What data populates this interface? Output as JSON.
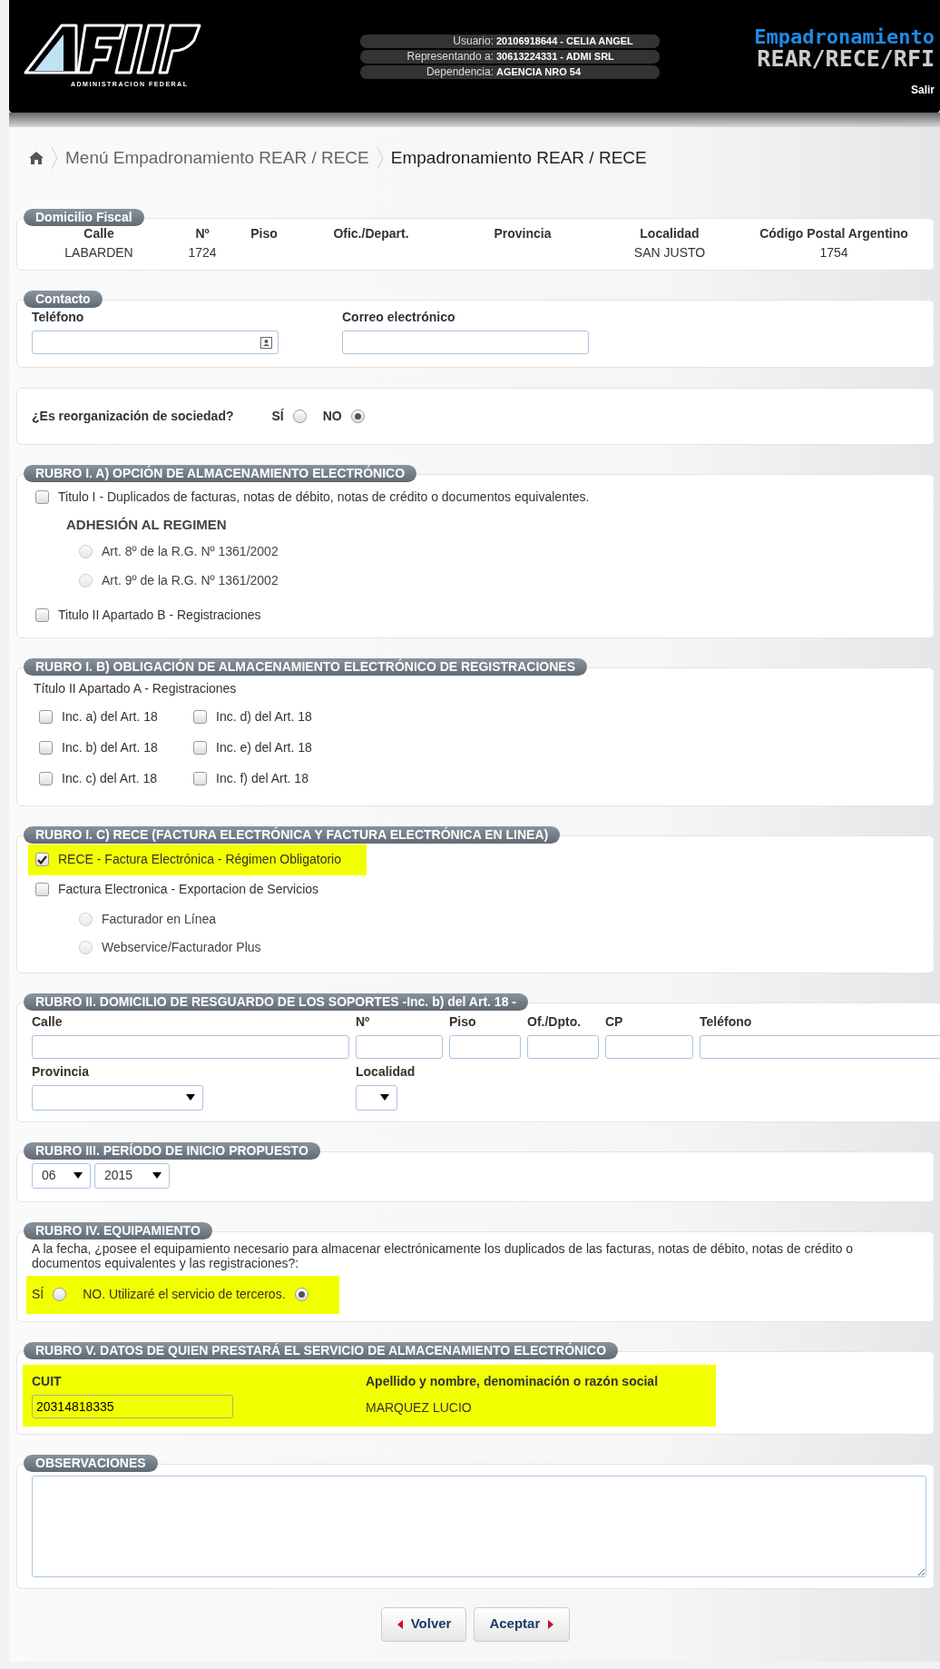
{
  "header": {
    "logo_caption": "ADMINISTRACION FEDERAL",
    "user_info": [
      {
        "label": "Usuario:",
        "value": "20106918644 - CELIA ANGEL"
      },
      {
        "label": "Representando a:",
        "value": "30613224331 - ADMI SRL"
      },
      {
        "label": "Dependencia:",
        "value": "AGENCIA NRO 54"
      }
    ],
    "app_title": "Empadronamiento",
    "app_subtitle": "REAR/RECE/RFI",
    "logout": "Salir"
  },
  "breadcrumb": [
    {
      "label": "Menú Empadronamiento REAR / RECE",
      "current": false
    },
    {
      "label": "Empadronamiento REAR / RECE",
      "current": true
    }
  ],
  "domicilio_fiscal": {
    "title": "Domicilio Fiscal",
    "columns": [
      {
        "label": "Calle",
        "value": "LABARDEN"
      },
      {
        "label": "Nº",
        "value": "1724"
      },
      {
        "label": "Piso"
      },
      {
        "label": "Ofic./Depart."
      },
      {
        "label": "Provincia"
      },
      {
        "label": "Localidad",
        "value": "SAN JUSTO"
      },
      {
        "label": "Código Postal Argentino",
        "value": "1754"
      }
    ]
  },
  "contacto": {
    "title": "Contacto",
    "fields": [
      {
        "label": "Teléfono",
        "kind": "phone"
      },
      {
        "label": "Correo electrónico",
        "kind": "text"
      }
    ]
  },
  "reorganizacion": {
    "question": "¿Es reorganización de sociedad?",
    "options": [
      {
        "label": "SÍ",
        "selected": false
      },
      {
        "label": "NO",
        "selected": true
      }
    ]
  },
  "rubro_1a": {
    "title": "RUBRO I. A) OPCIÓN DE ALMACENAMIENTO ELECTRÓNICO",
    "items": [
      {
        "kind": "checkbox",
        "label": "Titulo I - Duplicados de facturas, notas de débito, notas de crédito o documentos equivalentes.",
        "checked": false,
        "disabled": false
      },
      {
        "kind": "heading",
        "label": "ADHESIÓN AL REGIMEN"
      },
      {
        "kind": "radio",
        "label": "Art. 8º de la R.G. Nº 1361/2002",
        "checked": false,
        "disabled": true
      },
      {
        "kind": "radio",
        "label": "Art. 9º de la R.G. Nº 1361/2002",
        "checked": false,
        "disabled": true
      },
      {
        "kind": "checkbox",
        "label": "Titulo II Apartado B - Registraciones",
        "checked": false,
        "disabled": false
      }
    ]
  },
  "rubro_1b": {
    "title": "RUBRO I. B) OBLIGACIÓN DE ALMACENAMIENTO ELECTRÓNICO DE REGISTRACIONES",
    "subtitle": "Título II Apartado A - Registraciones",
    "options": [
      {
        "label": "Inc. a) del Art. 18",
        "checked": false
      },
      {
        "label": "Inc. d) del Art. 18",
        "checked": false
      },
      {
        "label": "Inc. b) del Art. 18",
        "checked": false
      },
      {
        "label": "Inc. e) del Art. 18",
        "checked": false
      },
      {
        "label": "Inc. c) del Art. 18",
        "checked": false
      },
      {
        "label": "Inc. f) del Art. 18",
        "checked": false
      }
    ]
  },
  "rubro_1c": {
    "title": "RUBRO I. C) RECE (FACTURA ELECTRÓNICA Y FACTURA ELECTRÓNICA EN LINEA)",
    "items": [
      {
        "kind": "checkbox",
        "label": "RECE - Factura Electrónica - Régimen Obligatorio",
        "checked": true,
        "disabled": false,
        "highlighted": true
      },
      {
        "kind": "checkbox",
        "label": "Factura Electronica - Exportacion de Servicios",
        "checked": false,
        "disabled": false,
        "highlighted": false
      },
      {
        "kind": "radio",
        "label": "Facturador en Línea",
        "checked": false,
        "disabled": true,
        "highlighted": false
      },
      {
        "kind": "radio",
        "label": "Webservice/Facturador Plus",
        "checked": false,
        "disabled": true,
        "highlighted": false
      }
    ]
  },
  "rubro_2": {
    "title": "RUBRO II. DOMICILIO DE RESGUARDO DE LOS SOPORTES -Inc. b) del Art. 18 -",
    "fields": [
      {
        "label": "Calle",
        "kind": "text"
      },
      {
        "label": "Nº",
        "kind": "text"
      },
      {
        "label": "Piso",
        "kind": "text"
      },
      {
        "label": "Of./Dpto.",
        "kind": "text"
      },
      {
        "label": "CP",
        "kind": "text"
      },
      {
        "label": "Teléfono",
        "kind": "text"
      },
      {
        "label": "Provincia",
        "kind": "select"
      },
      {
        "label": "Localidad",
        "kind": "select"
      }
    ]
  },
  "rubro_3": {
    "title": "RUBRO III. PERÍODO DE INICIO PROPUESTO",
    "selects": [
      {
        "value": "06"
      },
      {
        "value": "2015"
      }
    ]
  },
  "rubro_4": {
    "title": "RUBRO IV. EQUIPAMIENTO",
    "question": "A la fecha, ¿posee el equipamiento necesario para almacenar electrónicamente los duplicados de las facturas, notas de débito, notas de crédito o documentos equivalentes y las registraciones?:",
    "highlighted": true,
    "options": [
      {
        "label": "SÍ",
        "selected": false
      },
      {
        "label": "NO. Utilizaré el servicio de terceros.",
        "selected": true
      }
    ]
  },
  "rubro_5": {
    "title": "RUBRO V. DATOS DE QUIEN PRESTARÁ EL SERVICIO DE ALMACENAMIENTO ELECTRÓNICO",
    "highlighted": true,
    "cuit": {
      "label": "CUIT",
      "value": "20314818335"
    },
    "name": {
      "label": "Apellido y nombre, denominación o razón social",
      "value": "MARQUEZ LUCIO"
    }
  },
  "observaciones": {
    "title": "OBSERVACIONES"
  },
  "buttons": [
    {
      "label": "Volver",
      "kind": "back"
    },
    {
      "label": "Aceptar",
      "kind": "next"
    }
  ]
}
